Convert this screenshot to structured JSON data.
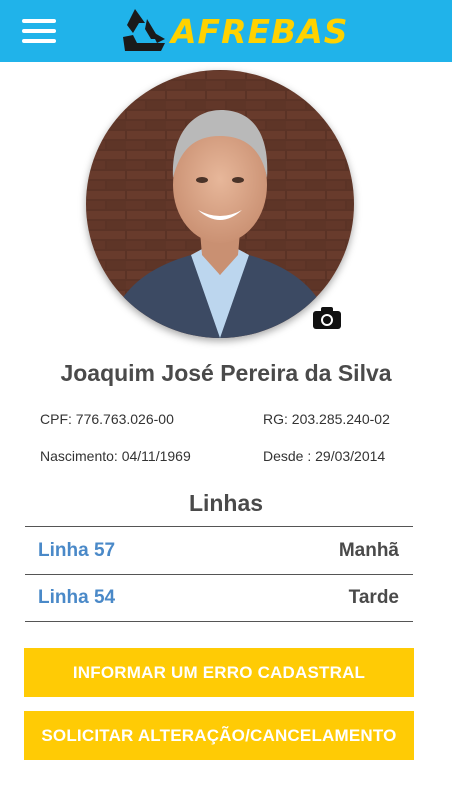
{
  "header": {
    "brand": "AFREBAS",
    "menu_icon": "hamburger-menu-icon",
    "colors": {
      "bar": "#20b3ea",
      "brand": "#ffd200"
    }
  },
  "profile": {
    "name": "Joaquim José Pereira da Silva",
    "cpf": "CPF: 776.763.026-00",
    "rg": "RG: 203.285.240-02",
    "birth": "Nascimento: 04/11/1969",
    "since": "Desde : 29/03/2014",
    "camera_icon": "camera-icon"
  },
  "lines": {
    "title": "Linhas",
    "items": [
      {
        "name": "Linha 57",
        "shift": "Manhã"
      },
      {
        "name": "Linha 54",
        "shift": "Tarde"
      }
    ]
  },
  "actions": {
    "report_error": "INFORMAR UM ERRO CADASTRAL",
    "request_change": "SOLICITAR ALTERAÇÃO/CANCELAMENTO",
    "button_color": "#ffcb05"
  }
}
